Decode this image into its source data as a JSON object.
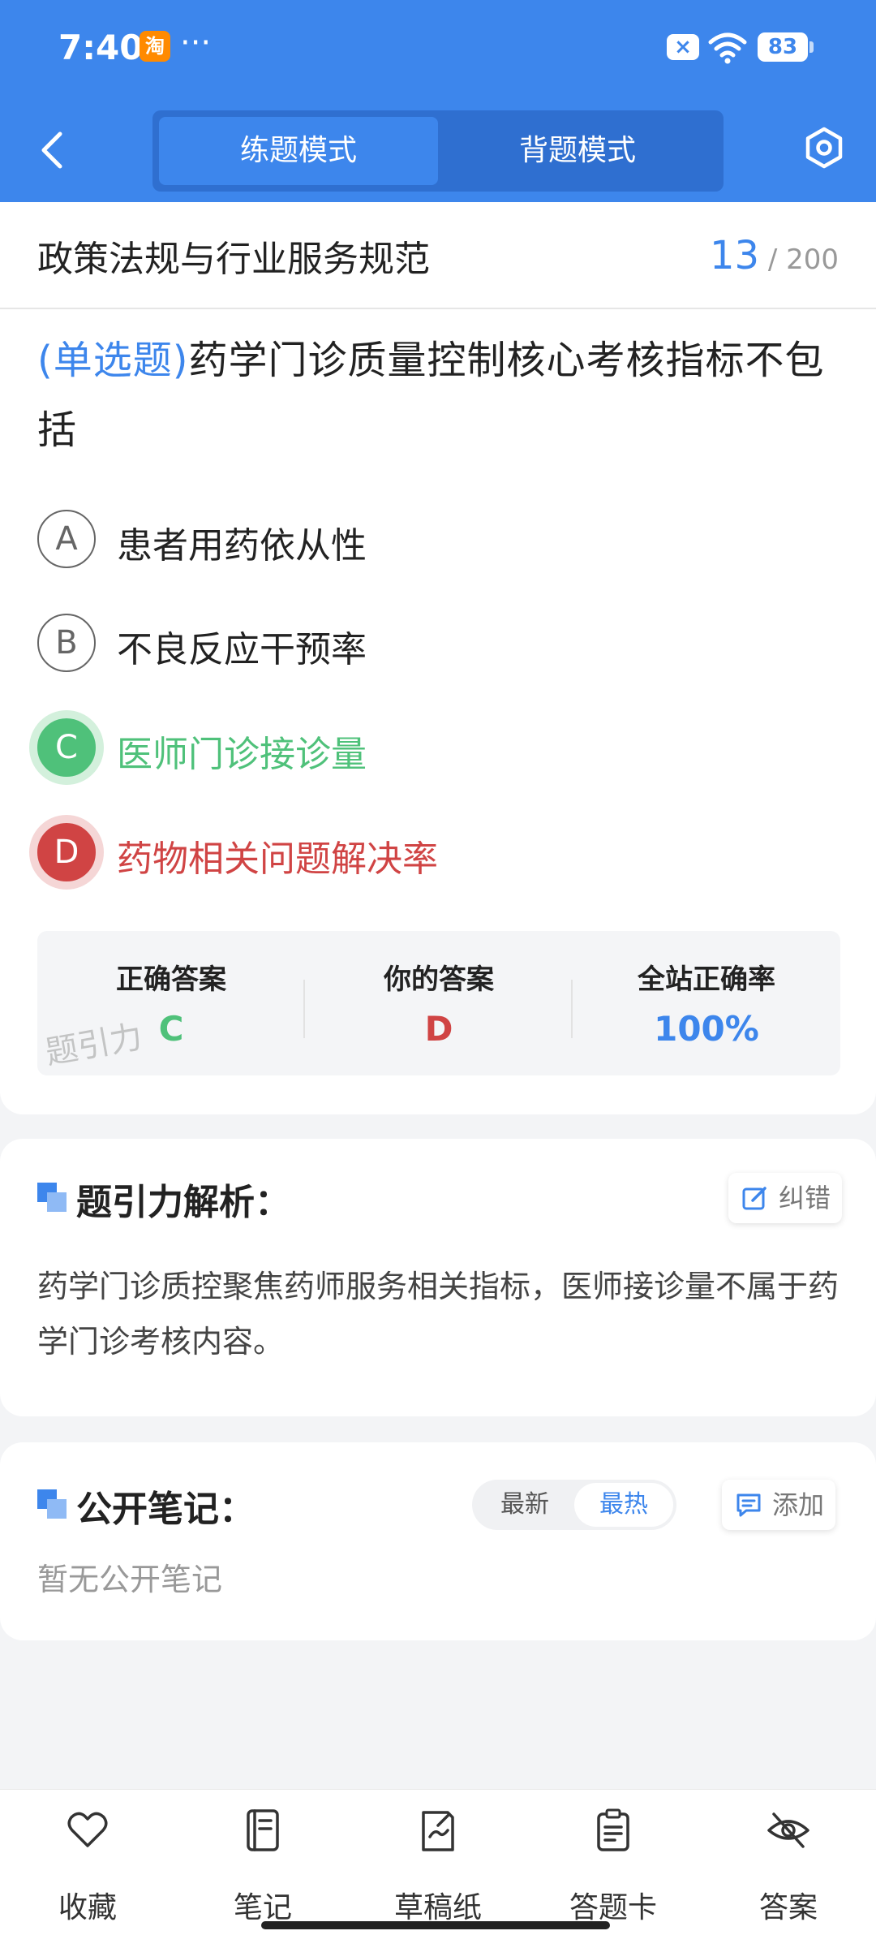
{
  "status_bar": {
    "time": "7:40",
    "app_badge": "淘",
    "more": "···",
    "sim_icon_text": "×",
    "battery": "83"
  },
  "header": {
    "tabs": [
      {
        "label": "练题模式",
        "active": true
      },
      {
        "label": "背题模式",
        "active": false
      }
    ]
  },
  "question": {
    "subject": "政策法规与行业服务规范",
    "current": "13",
    "total": "/ 200",
    "type": "(单选题)",
    "text": "药学门诊质量控制核心考核指标不包括",
    "options": [
      {
        "letter": "A",
        "text": "患者用药依从性",
        "state": "normal"
      },
      {
        "letter": "B",
        "text": "不良反应干预率",
        "state": "normal"
      },
      {
        "letter": "C",
        "text": "医师门诊接诊量",
        "state": "correct"
      },
      {
        "letter": "D",
        "text": "药物相关问题解决率",
        "state": "wrong"
      }
    ]
  },
  "result": {
    "correct_label": "正确答案",
    "correct_value": "C",
    "yours_label": "你的答案",
    "yours_value": "D",
    "rate_label": "全站正确率",
    "rate_value": "100%",
    "watermark": "题引力"
  },
  "analysis": {
    "title": "题引力解析：",
    "report_label": "纠错",
    "text": "药学门诊质控聚焦药师服务相关指标，医师接诊量不属于药学门诊考核内容。"
  },
  "notes": {
    "title": "公开笔记：",
    "sort_latest": "最新",
    "sort_hot": "最热",
    "add_label": "添加",
    "empty": "暂无公开笔记"
  },
  "bottom_nav": [
    {
      "label": "收藏",
      "icon": "heart-icon"
    },
    {
      "label": "笔记",
      "icon": "notebook-icon"
    },
    {
      "label": "草稿纸",
      "icon": "draft-icon"
    },
    {
      "label": "答题卡",
      "icon": "answer-card-icon"
    },
    {
      "label": "答案",
      "icon": "eye-off-icon"
    }
  ],
  "colors": {
    "brand": "#3d86ec",
    "correct": "#4fc17a",
    "wrong": "#d04444"
  }
}
